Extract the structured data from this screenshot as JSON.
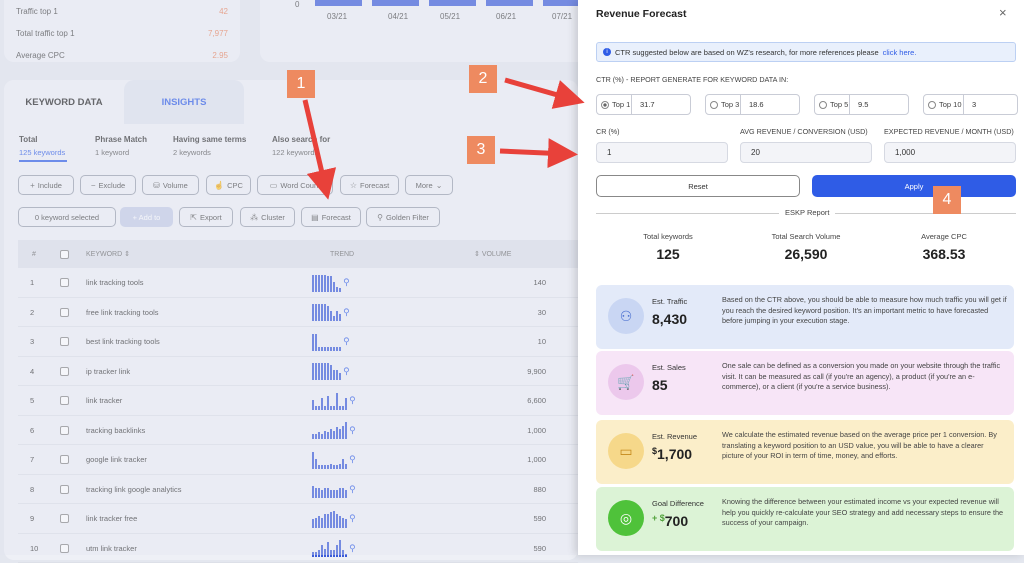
{
  "stats": [
    {
      "label": "Traffic top 1",
      "value": "42"
    },
    {
      "label": "Total traffic top 1",
      "value": "7,977"
    },
    {
      "label": "Average CPC",
      "value": "2.95"
    }
  ],
  "mini_chart": {
    "y_zero": "0",
    "months": [
      "03/21",
      "04/21",
      "05/21",
      "06/21",
      "07/21"
    ]
  },
  "tabs": {
    "keyword_data": "KEYWORD DATA",
    "insights": "INSIGHTS"
  },
  "subtabs": [
    {
      "title": "Total",
      "sub": "125 keywords"
    },
    {
      "title": "Phrase Match",
      "sub": "1 keyword"
    },
    {
      "title": "Having same terms",
      "sub": "2 keywords"
    },
    {
      "title": "Also search for",
      "sub": "122 keywords"
    }
  ],
  "toolbar1": {
    "include": "Include",
    "exclude": "Exclude",
    "volume": "Volume",
    "cpc": "CPC",
    "word_count": "Word Count",
    "forecast": "Forecast",
    "more": "More"
  },
  "toolbar2": {
    "selected": "0 keyword selected",
    "add_to": "+ Add to",
    "export": "Export",
    "cluster": "Cluster",
    "forecast": "Forecast",
    "golden_filter": "Golden Filter"
  },
  "table": {
    "headers": {
      "num": "#",
      "keyword": "KEYWORD",
      "trend": "TREND",
      "volume": "VOLUME"
    },
    "rows": [
      {
        "n": "1",
        "kw": "link tracking tools",
        "vol": "140"
      },
      {
        "n": "2",
        "kw": "free link tracking tools",
        "vol": "30"
      },
      {
        "n": "3",
        "kw": "best link tracking tools",
        "vol": "10"
      },
      {
        "n": "4",
        "kw": "ip tracker link",
        "vol": "9,900"
      },
      {
        "n": "5",
        "kw": "link tracker",
        "vol": "6,600"
      },
      {
        "n": "6",
        "kw": "tracking backlinks",
        "vol": "1,000"
      },
      {
        "n": "7",
        "kw": "google link tracker",
        "vol": "1,000"
      },
      {
        "n": "8",
        "kw": "tracking link google analytics",
        "vol": "880"
      },
      {
        "n": "9",
        "kw": "link tracker free",
        "vol": "590"
      },
      {
        "n": "10",
        "kw": "utm link tracker",
        "vol": "590"
      }
    ]
  },
  "panel": {
    "title": "Revenue Forecast",
    "close": "×",
    "info_text": "CTR suggested below are based on WZ's research, for more references please",
    "info_link": "click here.",
    "ctr_label": "CTR (%) - REPORT GENERATE FOR KEYWORD DATA IN:",
    "ctr": [
      {
        "label": "Top 1",
        "value": "31.7"
      },
      {
        "label": "Top 3",
        "value": "18.6"
      },
      {
        "label": "Top 5",
        "value": "9.5"
      },
      {
        "label": "Top 10",
        "value": "3"
      }
    ],
    "cr_label": "CR (%)",
    "cr_value": "1",
    "avg_label": "AVG REVENUE / CONVERSION (USD)",
    "avg_value": "20",
    "exp_label": "EXPECTED REVENUE / MONTH (USD)",
    "exp_value": "1,000",
    "reset": "Reset",
    "apply": "Apply",
    "report_label": "ESKP Report",
    "summary": [
      {
        "label": "Total keywords",
        "value": "125"
      },
      {
        "label": "Total Search Volume",
        "value": "26,590"
      },
      {
        "label": "Average CPC",
        "value": "368.53"
      }
    ],
    "cards": [
      {
        "name": "Est. Traffic",
        "value": "8,430",
        "desc": "Based on the CTR above, you should be able to measure how much traffic you will get if you reach the desired keyword position. It's an important metric to have forecasted before jumping in your execution stage."
      },
      {
        "name": "Est. Sales",
        "value": "85",
        "desc": "One sale can be defined as a conversion you made on your website through the traffic visit. It can be measured as call (if you're an agency), a product (if you're an e-commerce), or a client (if you're a service business)."
      },
      {
        "name": "Est. Revenue",
        "value_prefix": "$",
        "value": "1,700",
        "desc": "We calculate the estimated revenue based on the average price per 1 conversion. By translating a keyword position to an USD value, you will be able to have a clearer picture of your ROI in term of time, money, and efforts."
      },
      {
        "name": "Goal Difference",
        "value_prefix": "+ $",
        "value": "700",
        "desc": "Knowing the difference between your estimated income vs your expected revenue will help you quickly re-calculate your SEO strategy and add necessary steps to ensure the success of your campaign."
      }
    ]
  },
  "badges": [
    "1",
    "2",
    "3",
    "4"
  ],
  "colors": {
    "accent": "#2f5ce6",
    "badge": "#ee8a60",
    "arrow": "#e8413a",
    "orange": "#e9835d"
  }
}
